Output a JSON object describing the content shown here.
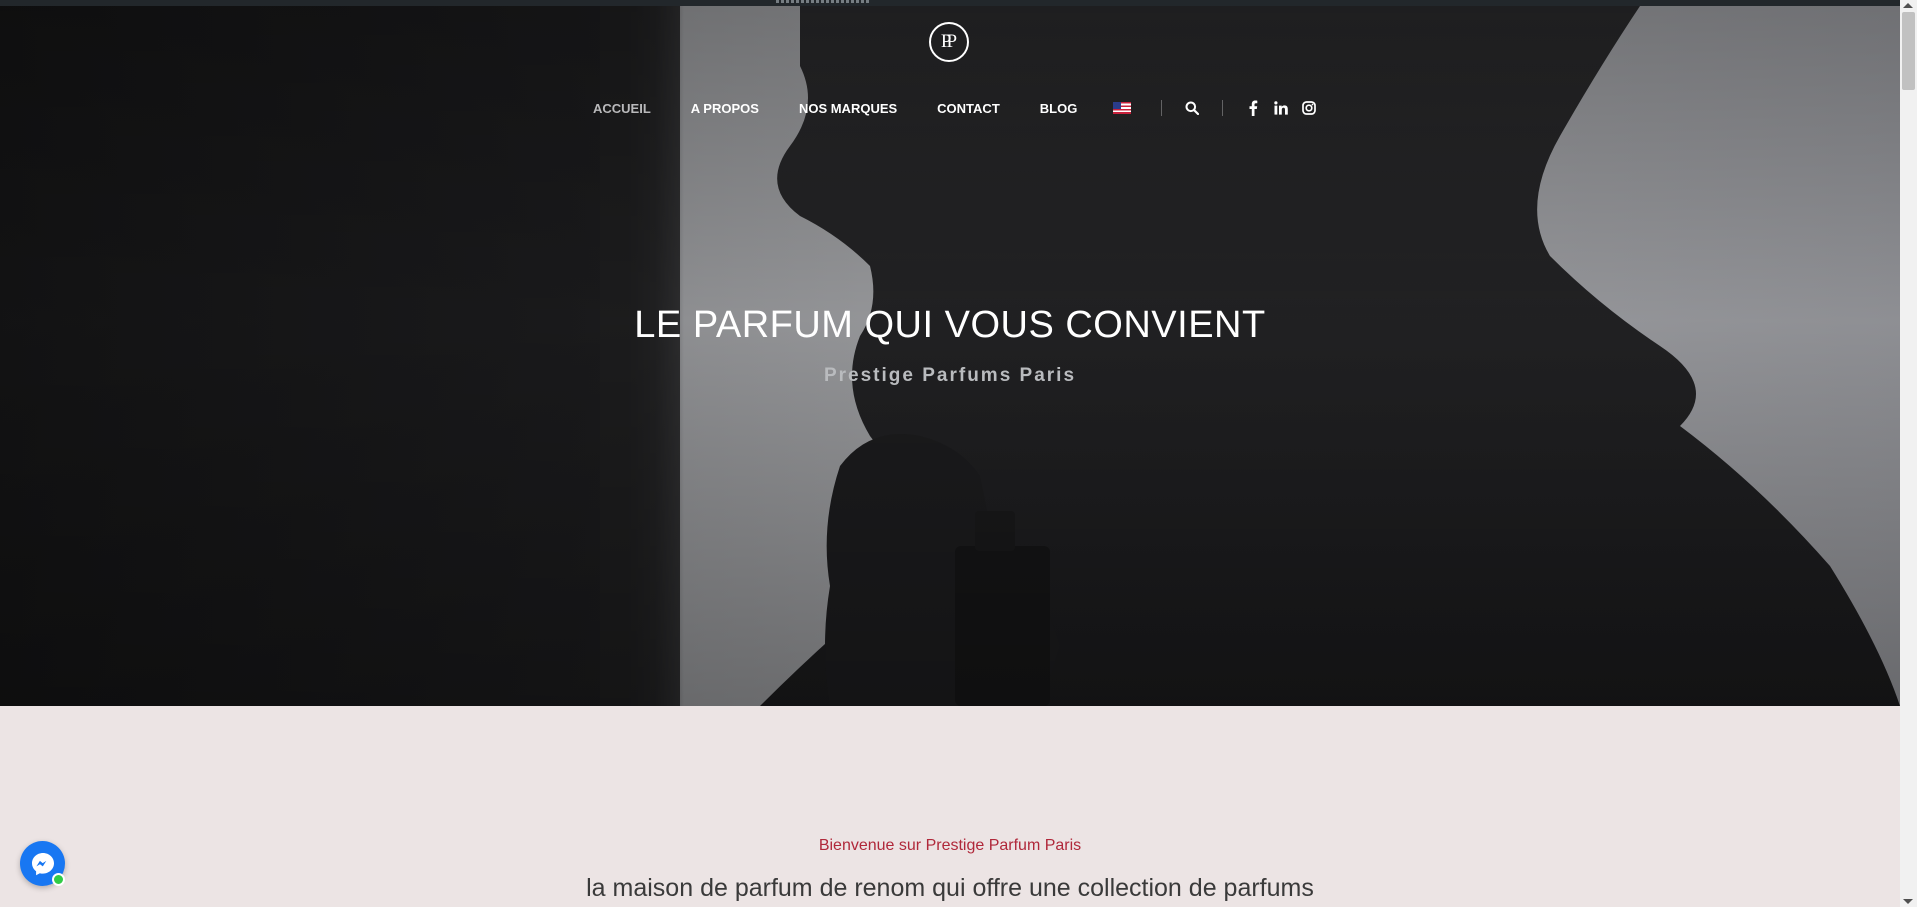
{
  "header": {
    "logo_text": "PP",
    "nav": [
      {
        "label": "ACCUEIL",
        "active": true
      },
      {
        "label": "A PROPOS",
        "active": false
      },
      {
        "label": "NOS MARQUES",
        "active": false
      },
      {
        "label": "CONTACT",
        "active": false
      },
      {
        "label": "BLOG",
        "active": false
      }
    ],
    "language_flag": "us-flag-icon",
    "icons": [
      "search-icon",
      "facebook-icon",
      "linkedin-icon",
      "instagram-icon"
    ]
  },
  "hero": {
    "title": "LE PARFUM QUI VOUS CONVIENT",
    "subtitle": "Prestige Parfums Paris"
  },
  "welcome": {
    "kicker": "Bienvenue sur Prestige Parfum Paris",
    "lead": "la maison de parfum de renom qui offre une collection de parfums"
  },
  "messenger": {
    "icon": "messenger-icon",
    "status": "online"
  },
  "colors": {
    "accent_red": "#b0283a",
    "nav_active": "#b9b9bb",
    "section_bg": "#ece4e4",
    "messenger_blue": "#1877f2",
    "online_green": "#31cc46"
  }
}
